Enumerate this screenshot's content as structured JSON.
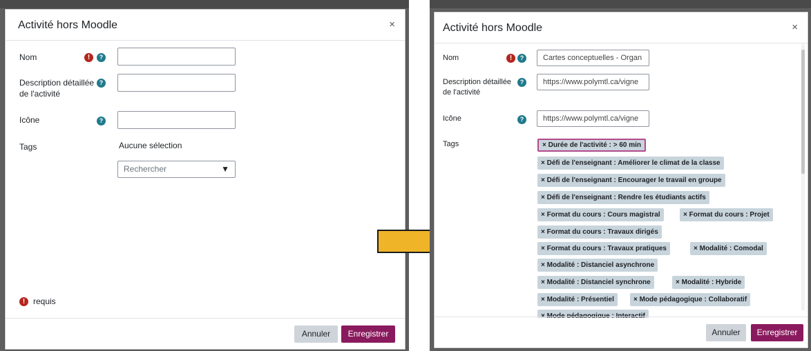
{
  "left": {
    "modal": {
      "title": "Activité hors Moodle",
      "close": "×",
      "fields": {
        "nom_label": "Nom",
        "description_label": "Description détaillée",
        "description_label_2": "de l'activité",
        "icone_label": "Icône",
        "tags_label": "Tags",
        "nom_value": "",
        "description_value": "",
        "icone_value": ""
      },
      "tags": {
        "none_selected": "Aucune sélection",
        "search_placeholder": "Rechercher",
        "arrow": "▼"
      },
      "required_note": "requis",
      "buttons": {
        "cancel": "Annuler",
        "save": "Enregistrer"
      }
    }
  },
  "right": {
    "modal": {
      "title": "Activité hors Moodle",
      "close": "×",
      "fields": {
        "nom_label": "Nom",
        "description_label": "Description détaillée",
        "description_label_2": "de l'activité",
        "icone_label": "Icône",
        "tags_label": "Tags",
        "nom_value": "Cartes conceptuelles - Organ",
        "description_value": "https://www.polymtl.ca/vigne",
        "icone_value": "https://www.polymtl.ca/vigne"
      },
      "selected_tags": [
        "× Durée de l'activité : > 60 min",
        "× Défi de l'enseignant : Améliorer le climat de la classe",
        "× Défi de l'enseignant : Encourager le travail en groupe",
        "× Défi de l'enseignant : Rendre les étudiants actifs",
        "× Format du cours : Cours magistral",
        "× Format du cours : Projet",
        "× Format du cours : Travaux dirigés",
        "× Format du cours : Travaux pratiques",
        "× Modalité : Comodal",
        "× Modalité : Distanciel asynchrone",
        "× Modalité : Distanciel synchrone",
        "× Modalité : Hybride",
        "× Modalité : Présentiel",
        "× Mode pédagogique : Collaboratif",
        "× Mode pédagogique : Interactif"
      ],
      "buttons": {
        "cancel": "Annuler",
        "save": "Enregistrer"
      }
    }
  },
  "icons": {
    "required": "!",
    "help": "?",
    "arrow": "arrow-right-icon"
  },
  "colors": {
    "primary": "#8a1a5e",
    "required": "#b3261e",
    "help": "#0f6cbf",
    "tag_bg": "#c8d4dc",
    "arrow_fill": "#f0b429"
  }
}
